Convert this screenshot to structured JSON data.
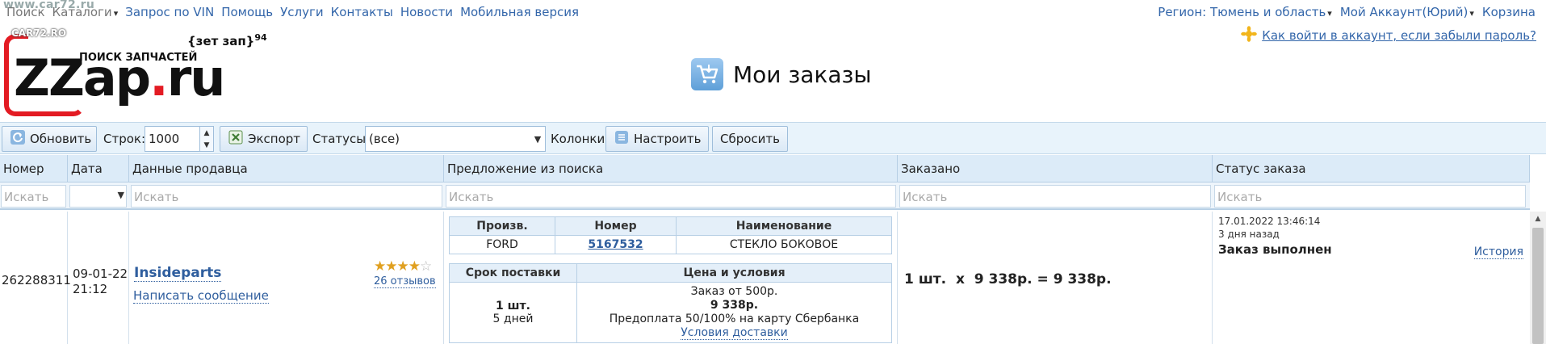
{
  "watermark": "www.car72.ru",
  "watermark_logo": "CAR72.RO",
  "nav": {
    "left": [
      {
        "label": "Поиск"
      },
      {
        "label": "Каталоги"
      },
      {
        "label": "Запрос по VIN"
      },
      {
        "label": "Помощь"
      },
      {
        "label": "Услуги"
      },
      {
        "label": "Контакты"
      },
      {
        "label": "Новости"
      },
      {
        "label": "Мобильная версия"
      }
    ],
    "region": "Регион: Тюмень и область",
    "account": "Мой Аккаунт(Юрий)",
    "cart": "Корзина"
  },
  "logo": {
    "zz": "ZZ",
    "ap": "ap",
    "dot": ".",
    "ru": "ru",
    "tagline": "ПОИСК ЗАПЧАСТЕЙ",
    "zet": "{зет зап}",
    "zet_sup": "94"
  },
  "page": {
    "title": "Мои заказы",
    "help_link": "Как войти в аккаунт, если забыли пароль?"
  },
  "toolbar": {
    "refresh": "Обновить",
    "rows_label": "Строк:",
    "rows_value": "1000",
    "export": "Экспорт",
    "statuses_label": "Статусы:",
    "statuses_value": "(все)",
    "columns_label": "Колонки:",
    "configure": "Настроить",
    "reset": "Сбросить"
  },
  "grid": {
    "headers": [
      "Номер",
      "Дата",
      "Данные продавца",
      "Предложение из поиска",
      "Заказано",
      "Статус заказа"
    ],
    "filter_placeholder": "Искать",
    "row": {
      "number": "262288311",
      "date": "09-01-22",
      "time": "21:12",
      "seller": "Insideparts",
      "write_message": "Написать сообщение",
      "reviews": "26 отзывов",
      "rating": 4,
      "rating_max": 5,
      "offer": {
        "h_brand": "Произв.",
        "h_number": "Номер",
        "h_name": "Наименование",
        "brand": "FORD",
        "number": "5167532",
        "name": "СТЕКЛО БОКОВОЕ",
        "h_delivery": "Срок поставки",
        "h_price": "Цена и условия",
        "qty": "1 шт.",
        "days": "5 дней",
        "min_order": "Заказ от 500р.",
        "price": "9 338р.",
        "prepay": "Предоплата 50/100% на карту Сбербанка",
        "delivery_terms": "Условия доставки"
      },
      "ordered": "1 шт.  x  9 338р. = 9 338р.",
      "status_datetime": "17.01.2022 13:46:14",
      "status_ago": "3 дня назад",
      "status": "Заказ выполнен",
      "history": "История"
    }
  },
  "colors": {
    "brand_red": "#e31b23",
    "link": "#3366aa",
    "header_bg": "#dcebf8",
    "toolbar_bg": "#e8f3fb"
  }
}
